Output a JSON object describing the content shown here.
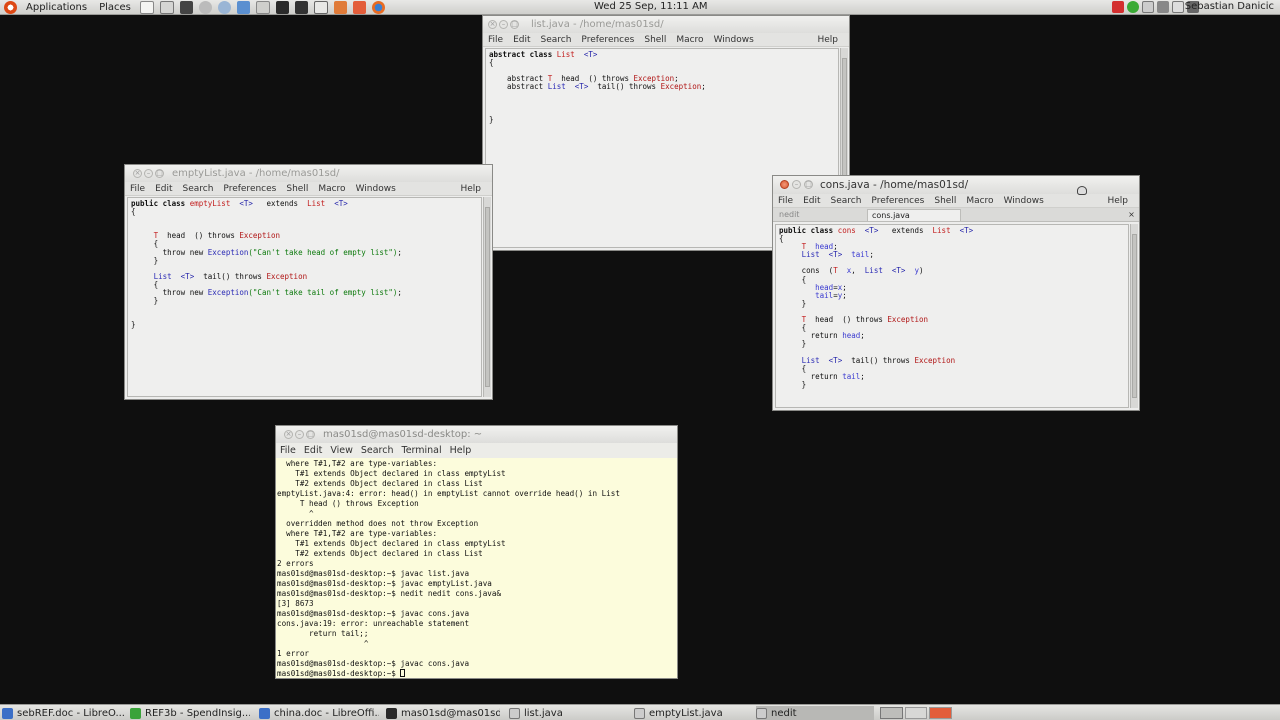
{
  "top_panel": {
    "applications": "Applications",
    "places": "Places",
    "clock": "Wed 25 Sep, 11:11 AM",
    "user": "Sebastian Danicic"
  },
  "windows": {
    "list": {
      "title": "list.java - /home/mas01sd/",
      "menu": [
        "File",
        "Edit",
        "Search",
        "Preferences",
        "Shell",
        "Macro",
        "Windows"
      ],
      "help": "Help"
    },
    "emptyList": {
      "title": "emptyList.java - /home/mas01sd/",
      "menu": [
        "File",
        "Edit",
        "Search",
        "Preferences",
        "Shell",
        "Macro",
        "Windows"
      ],
      "help": "Help"
    },
    "cons": {
      "title": "cons.java - /home/mas01sd/",
      "menu": [
        "File",
        "Edit",
        "Search",
        "Preferences",
        "Shell",
        "Macro",
        "Windows"
      ],
      "help": "Help",
      "tabs": [
        "nedit",
        "cons.java"
      ]
    },
    "terminal": {
      "title": "mas01sd@mas01sd-desktop: ~",
      "menu": [
        "File",
        "Edit",
        "View",
        "Search",
        "Terminal",
        "Help"
      ]
    }
  },
  "taskbar": [
    "sebREF.doc - LibreO...",
    "REF3b - SpendInsig...",
    "china.doc - LibreOffi...",
    "mas01sd@mas01sd-...",
    "list.java",
    "emptyList.java",
    "nedit"
  ],
  "code": {
    "list": [
      [
        [
          "kw",
          "abstract class "
        ],
        [
          "red",
          "List"
        ],
        [
          "",
          "  "
        ],
        [
          "tp",
          "<T>"
        ]
      ],
      [
        [
          "",
          "{"
        ]
      ],
      [
        [
          "",
          ""
        ]
      ],
      [
        [
          "",
          "    abstract "
        ],
        [
          "red",
          "T"
        ],
        [
          "",
          ""
        ],
        [
          "",
          "  head  () throws "
        ],
        [
          "exc",
          "Exception"
        ],
        [
          "",
          ";"
        ]
      ],
      [
        [
          "",
          "    abstract "
        ],
        [
          "ty",
          "List"
        ],
        [
          "",
          "  "
        ],
        [
          "tp",
          "<T>"
        ],
        [
          "",
          "  tail() throws "
        ],
        [
          "exc",
          "Exception"
        ],
        [
          "",
          ";"
        ]
      ],
      [
        [
          "",
          ""
        ]
      ],
      [
        [
          "",
          ""
        ]
      ],
      [
        [
          "",
          ""
        ]
      ],
      [
        [
          "",
          "}"
        ]
      ]
    ],
    "emptyList": [
      [
        [
          "kw",
          "public class "
        ],
        [
          "red",
          "emptyList"
        ],
        [
          "",
          "  "
        ],
        [
          "tp",
          "<T>"
        ],
        [
          "",
          "   extends  "
        ],
        [
          "red",
          "List"
        ],
        [
          "",
          "  "
        ],
        [
          "tp",
          "<T>"
        ]
      ],
      [
        [
          "",
          "{"
        ]
      ],
      [
        [
          "",
          ""
        ]
      ],
      [
        [
          "",
          ""
        ]
      ],
      [
        [
          "",
          "     "
        ],
        [
          "red",
          "T"
        ],
        [
          "",
          "  head  () throws "
        ],
        [
          "exc",
          "Exception"
        ]
      ],
      [
        [
          "",
          "     {"
        ]
      ],
      [
        [
          "",
          "       throw new "
        ],
        [
          "ty",
          "Exception"
        ],
        [
          "str",
          "(\"Can't take head of empty list\")"
        ],
        [
          "",
          ";"
        ]
      ],
      [
        [
          "",
          "     }"
        ]
      ],
      [
        [
          "",
          ""
        ]
      ],
      [
        [
          "",
          "     "
        ],
        [
          "ty",
          "List"
        ],
        [
          "",
          "  "
        ],
        [
          "tp",
          "<T>"
        ],
        [
          "",
          "  tail() throws "
        ],
        [
          "exc",
          "Exception"
        ]
      ],
      [
        [
          "",
          "     {"
        ]
      ],
      [
        [
          "",
          "       throw new "
        ],
        [
          "ty",
          "Exception"
        ],
        [
          "str",
          "(\"Can't take tail of empty list\")"
        ],
        [
          "",
          ";"
        ]
      ],
      [
        [
          "",
          "     }"
        ]
      ],
      [
        [
          "",
          ""
        ]
      ],
      [
        [
          "",
          ""
        ]
      ],
      [
        [
          "",
          "}"
        ]
      ]
    ],
    "cons": [
      [
        [
          "kw",
          "public class "
        ],
        [
          "red",
          "cons"
        ],
        [
          "",
          "  "
        ],
        [
          "tp",
          "<T>"
        ],
        [
          "",
          "   extends  "
        ],
        [
          "red",
          "List"
        ],
        [
          "",
          "  "
        ],
        [
          "tp",
          "<T>"
        ]
      ],
      [
        [
          "",
          "{"
        ]
      ],
      [
        [
          "",
          "     "
        ],
        [
          "red",
          "T"
        ],
        [
          "",
          "  "
        ],
        [
          "var",
          "head"
        ],
        [
          "",
          ";"
        ]
      ],
      [
        [
          "",
          "     "
        ],
        [
          "ty",
          "List"
        ],
        [
          "",
          "  "
        ],
        [
          "tp",
          "<T>"
        ],
        [
          "",
          "  "
        ],
        [
          "var",
          "tail"
        ],
        [
          "",
          ";"
        ]
      ],
      [
        [
          "",
          ""
        ]
      ],
      [
        [
          "",
          "     cons  ("
        ],
        [
          "red",
          "T"
        ],
        [
          "",
          "  "
        ],
        [
          "var",
          "x"
        ],
        [
          "",
          ",  "
        ],
        [
          "ty",
          "List"
        ],
        [
          "",
          "  "
        ],
        [
          "tp",
          "<T>"
        ],
        [
          "",
          "  "
        ],
        [
          "var",
          "y"
        ],
        [
          "",
          ")"
        ]
      ],
      [
        [
          "",
          "     {"
        ]
      ],
      [
        [
          "",
          "        "
        ],
        [
          "var",
          "head"
        ],
        [
          "",
          "="
        ],
        [
          "var",
          "x"
        ],
        [
          "",
          ";"
        ]
      ],
      [
        [
          "",
          "        "
        ],
        [
          "var",
          "tail"
        ],
        [
          "",
          "="
        ],
        [
          "var",
          "y"
        ],
        [
          "",
          ";"
        ]
      ],
      [
        [
          "",
          "     }"
        ]
      ],
      [
        [
          "",
          ""
        ]
      ],
      [
        [
          "",
          "     "
        ],
        [
          "red",
          "T"
        ],
        [
          "",
          "  head  () throws "
        ],
        [
          "exc",
          "Exception"
        ]
      ],
      [
        [
          "",
          "     {"
        ]
      ],
      [
        [
          "",
          "       return "
        ],
        [
          "var",
          "head"
        ],
        [
          "",
          ";"
        ]
      ],
      [
        [
          "",
          "     }"
        ]
      ],
      [
        [
          "",
          ""
        ]
      ],
      [
        [
          "",
          "     "
        ],
        [
          "ty",
          "List"
        ],
        [
          "",
          "  "
        ],
        [
          "tp",
          "<T>"
        ],
        [
          "",
          "  tail() throws "
        ],
        [
          "exc",
          "Exception"
        ]
      ],
      [
        [
          "",
          "     {"
        ]
      ],
      [
        [
          "",
          "       return "
        ],
        [
          "var",
          "tail"
        ],
        [
          "",
          ";"
        ]
      ],
      [
        [
          "",
          "     }"
        ]
      ]
    ]
  },
  "terminal_lines": [
    "  where T#1,T#2 are type-variables:",
    "    T#1 extends Object declared in class emptyList",
    "    T#2 extends Object declared in class List",
    "emptyList.java:4: error: head() in emptyList cannot override head() in List",
    "     T head () throws Exception",
    "       ^",
    "  overridden method does not throw Exception",
    "  where T#1,T#2 are type-variables:",
    "    T#1 extends Object declared in class emptyList",
    "    T#2 extends Object declared in class List",
    "2 errors",
    "mas01sd@mas01sd-desktop:~$ javac list.java",
    "mas01sd@mas01sd-desktop:~$ javac emptyList.java",
    "mas01sd@mas01sd-desktop:~$ nedit nedit cons.java&",
    "[3] 8673",
    "mas01sd@mas01sd-desktop:~$ javac cons.java",
    "cons.java:19: error: unreachable statement",
    "       return tail;;",
    "                   ^",
    "1 error",
    "mas01sd@mas01sd-desktop:~$ javac cons.java",
    "mas01sd@mas01sd-desktop:~$ "
  ]
}
